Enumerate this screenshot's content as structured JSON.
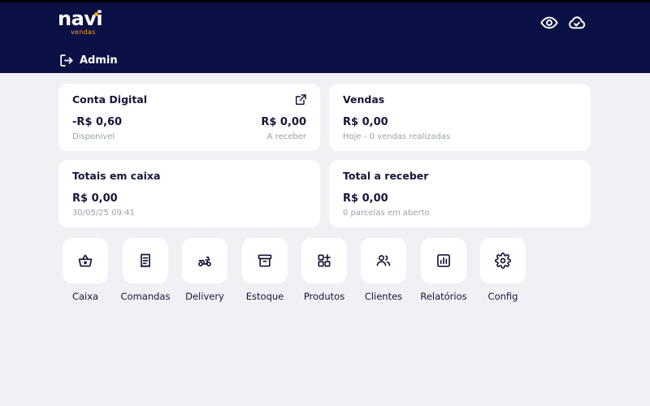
{
  "brand": {
    "name": "navi",
    "tagline": "vendas"
  },
  "header": {
    "user": "Admin"
  },
  "cards": {
    "conta_digital": {
      "title": "Conta Digital",
      "balance": "-R$ 0,60",
      "balance_label": "Disponível",
      "receivable": "R$ 0,00",
      "receivable_label": "A receber"
    },
    "vendas": {
      "title": "Vendas",
      "amount": "R$ 0,00",
      "detail": "Hoje - 0 vendas realizadas"
    },
    "totais_caixa": {
      "title": "Totais em caixa",
      "amount": "R$ 0,00",
      "detail": "30/05/25 09:41"
    },
    "total_receber": {
      "title": "Total a receber",
      "amount": "R$ 0,00",
      "detail": "0 parcelas em aberto"
    }
  },
  "shortcuts": [
    {
      "label": "Caixa",
      "icon": "basket-icon"
    },
    {
      "label": "Comandas",
      "icon": "receipt-icon"
    },
    {
      "label": "Delivery",
      "icon": "scooter-icon"
    },
    {
      "label": "Estoque",
      "icon": "archive-box-icon"
    },
    {
      "label": "Produtos",
      "icon": "grid-plus-icon"
    },
    {
      "label": "Clientes",
      "icon": "users-icon"
    },
    {
      "label": "Relatórios",
      "icon": "bar-chart-icon"
    },
    {
      "label": "Config",
      "icon": "gear-icon"
    }
  ],
  "colors": {
    "header_bg": "#0b1145",
    "accent": "#f3a218",
    "page_bg": "#eff1f5",
    "text": "#15163a",
    "muted": "#9aa0ad"
  }
}
